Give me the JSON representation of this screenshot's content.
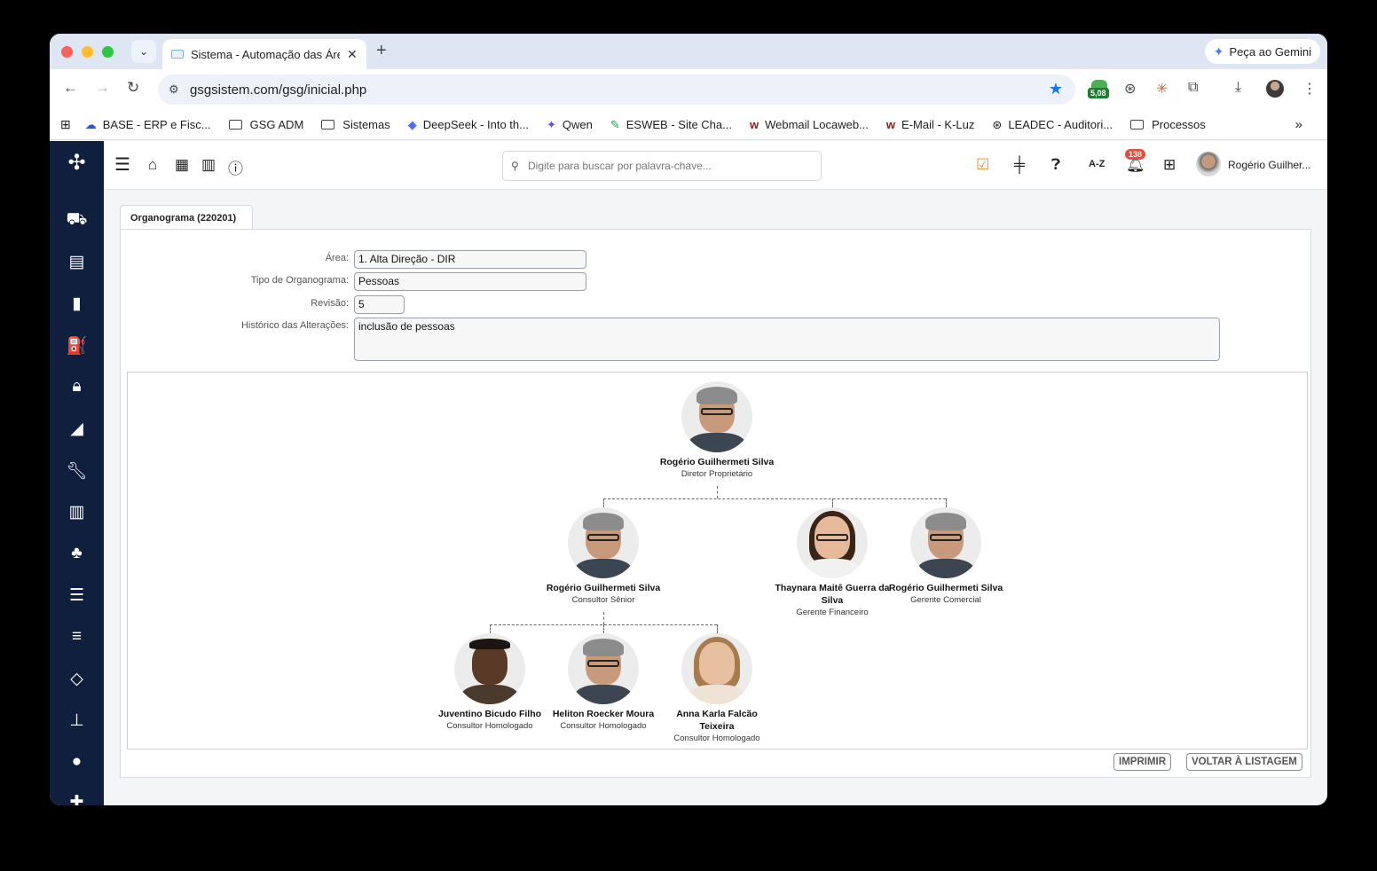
{
  "browser": {
    "tab_title": "Sistema - Automação das Áre",
    "close_glyph": "✕",
    "new_tab_glyph": "+",
    "gemini_label": "Peça ao Gemini",
    "url": "gsgsistem.com/gsg/inicial.php",
    "extension_badge": "5,08",
    "bookmarks": [
      {
        "label": "BASE - ERP e Fisc...",
        "icon": "cloud-icon"
      },
      {
        "label": "GSG ADM",
        "icon": "folder-icon"
      },
      {
        "label": "Sistemas",
        "icon": "folder-icon"
      },
      {
        "label": "DeepSeek - Into th...",
        "icon": "deepseek-icon"
      },
      {
        "label": "Qwen",
        "icon": "qwen-icon"
      },
      {
        "label": "ESWEB - Site Cha...",
        "icon": "esweb-icon"
      },
      {
        "label": "Webmail Locaweb...",
        "icon": "webmail-icon"
      },
      {
        "label": "E-Mail - K-Luz",
        "icon": "webmail-icon"
      },
      {
        "label": "LEADEC - Auditori...",
        "icon": "openai-icon"
      },
      {
        "label": "Processos",
        "icon": "folder-icon"
      }
    ],
    "bookmarks_overflow": "»"
  },
  "app": {
    "search_placeholder": "Digite para buscar por palavra-chave...",
    "az_label": "A-Z",
    "notification_count": "138",
    "user_name": "Rogério Guilher..."
  },
  "content": {
    "tab_label": "Organograma  (220201)",
    "form": {
      "area_label": "Área:",
      "area_value": "1. Alta Direção - DIR",
      "tipo_label": "Tipo de Organograma:",
      "tipo_value": "Pessoas",
      "revisao_label": "Revisão:",
      "revisao_value": "5",
      "historico_label": "Histórico das Alterações:",
      "historico_value": "inclusão de pessoas"
    },
    "org": {
      "root": {
        "name": "Rogério Guilhermeti Silva",
        "role": "Diretor Proprietário"
      },
      "level1": [
        {
          "name": "Rogério Guilhermeti Silva",
          "role": "Consultor Sênior"
        },
        {
          "name": "Thaynara Maitê Guerra da Silva",
          "role": "Gerente Financeiro"
        },
        {
          "name": "Rogério Guilhermeti Silva",
          "role": "Gerente Comercial"
        }
      ],
      "level2": [
        {
          "name": "Juventino Bicudo Filho",
          "role": "Consultor Homologado"
        },
        {
          "name": "Heliton Roecker Moura",
          "role": "Consultor Homologado"
        },
        {
          "name": "Anna Karla Falcão Teixeira",
          "role": "Consultor Homologado"
        }
      ]
    },
    "buttons": {
      "print": "IMPRIMIR",
      "back": "VOLTAR À LISTAGEM"
    }
  }
}
